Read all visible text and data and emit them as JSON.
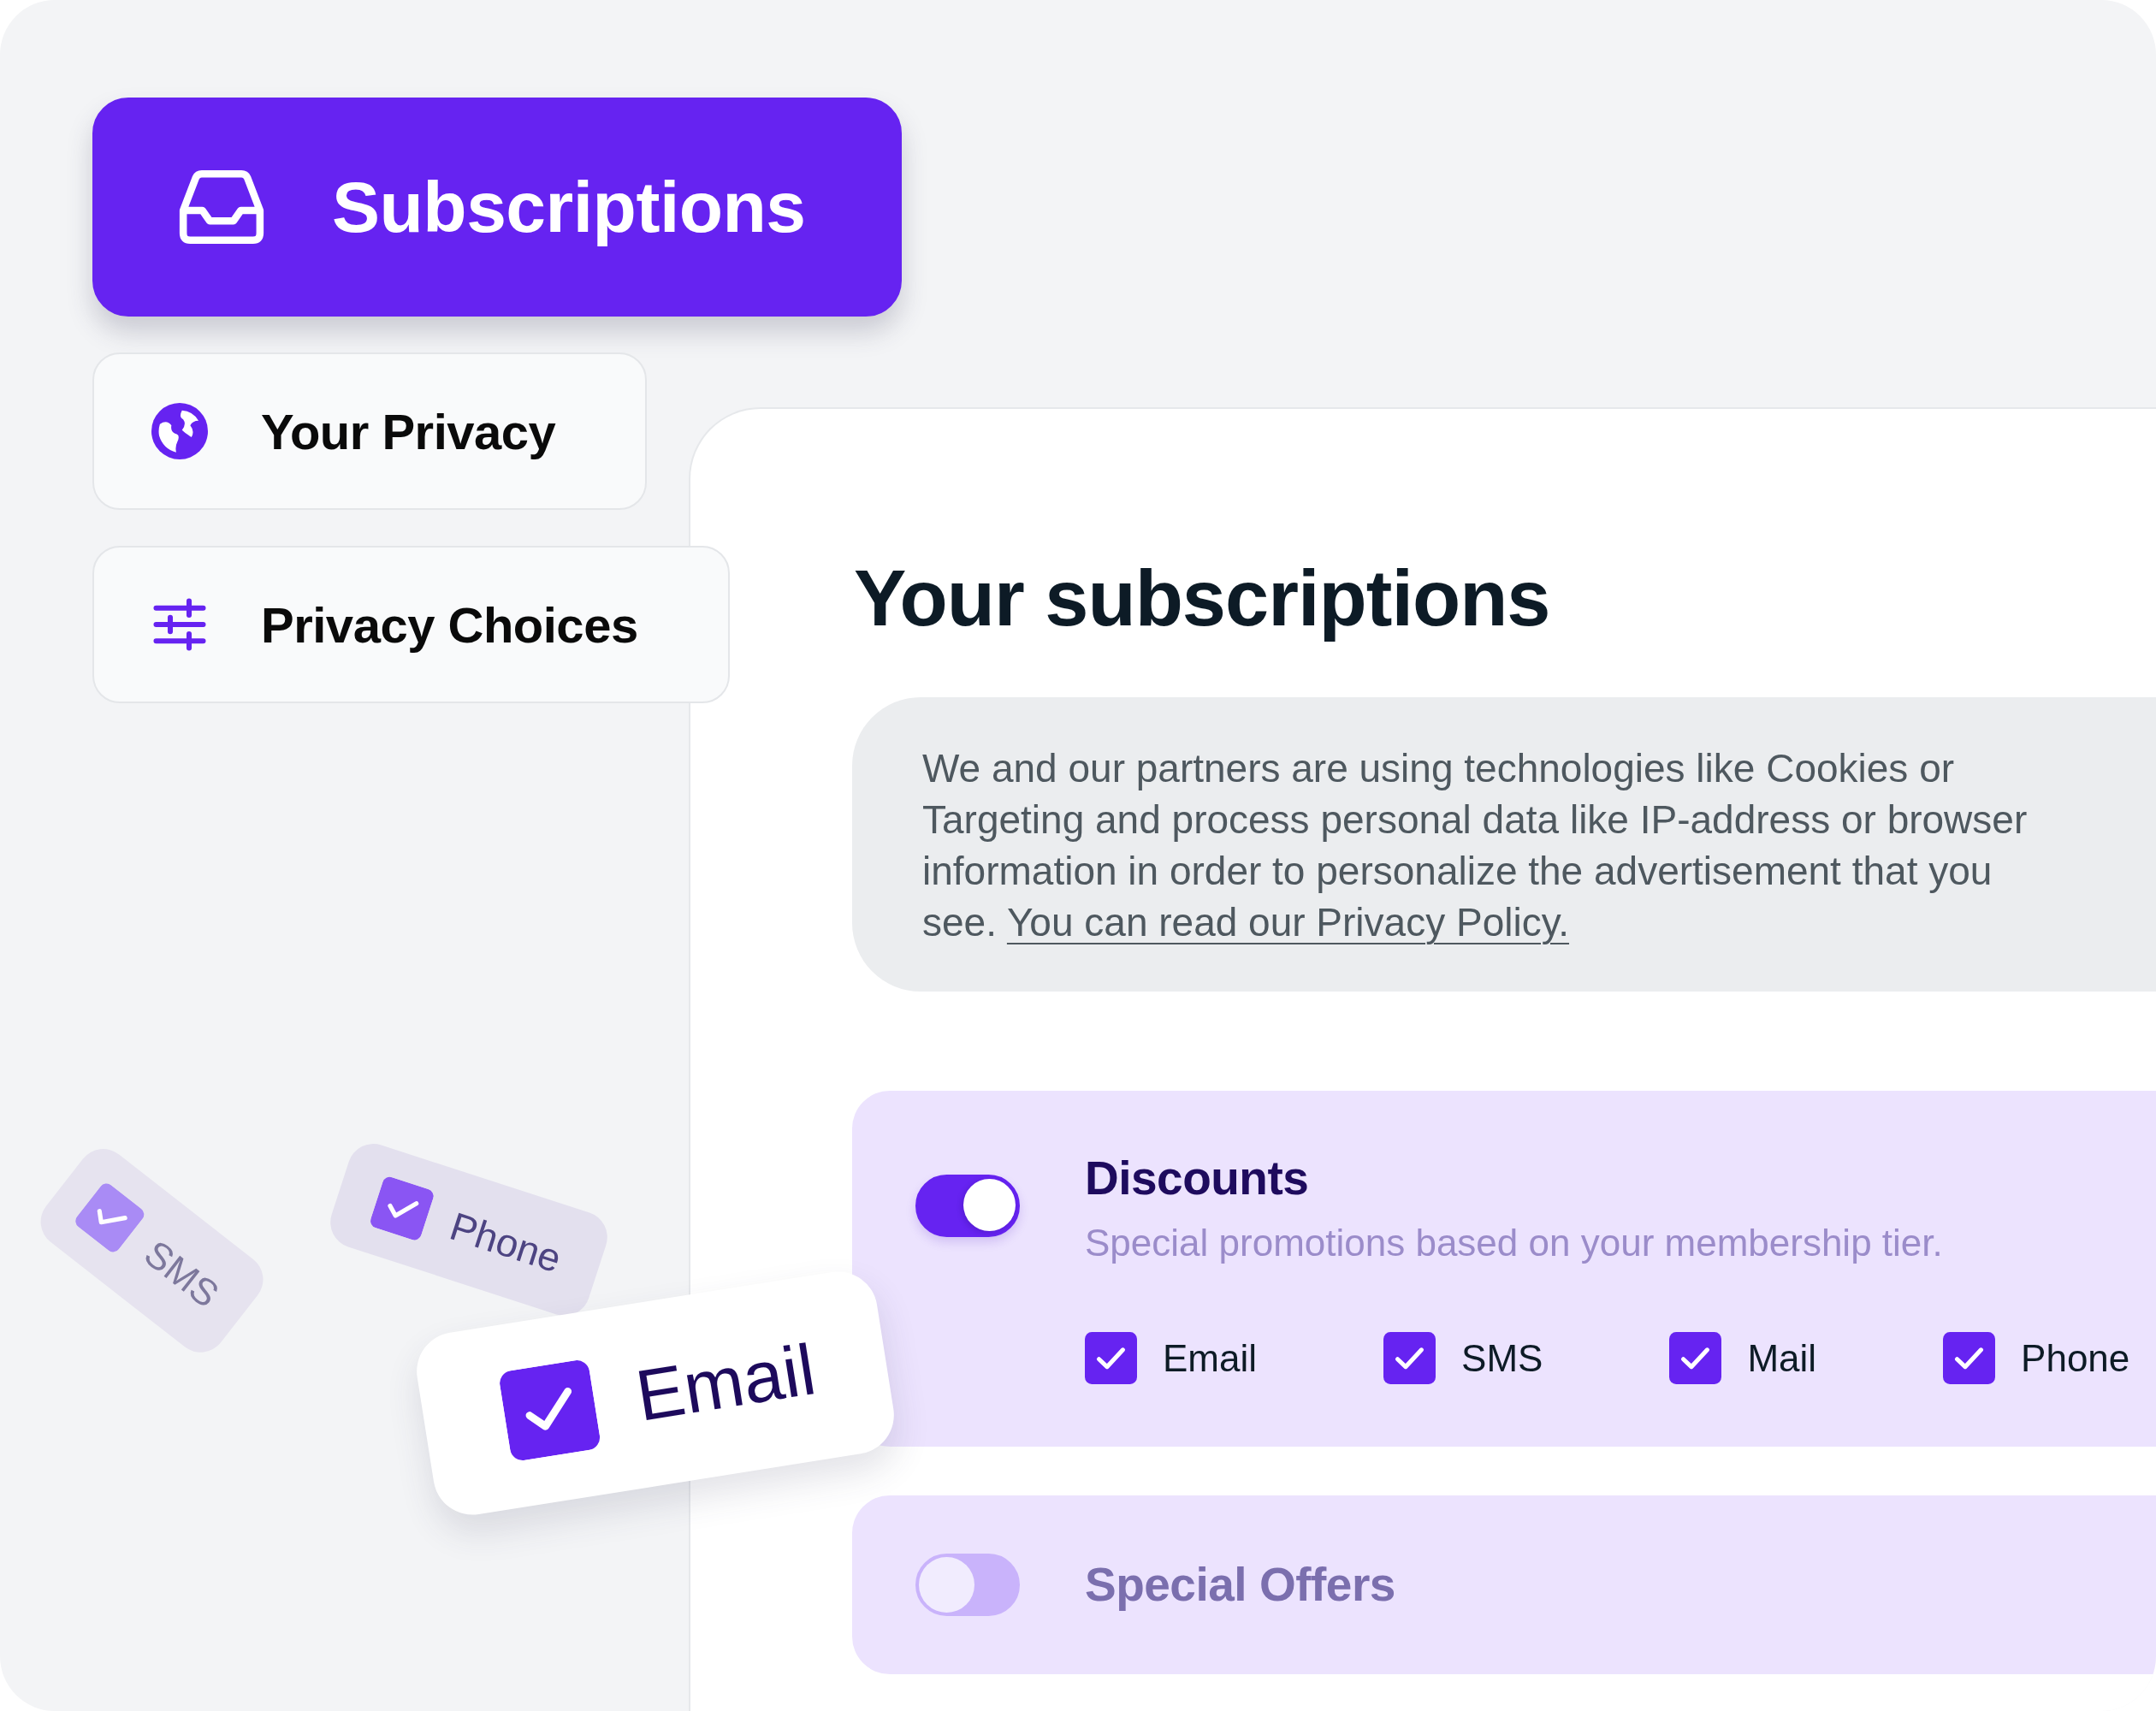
{
  "nav": [
    {
      "label": "Subscriptions",
      "selected": true
    },
    {
      "label": "Your Privacy",
      "selected": false
    },
    {
      "label": "Privacy Choices",
      "selected": false
    }
  ],
  "floating_chips": [
    {
      "label": "SMS",
      "checked": true,
      "kind": "back"
    },
    {
      "label": "Phone",
      "checked": true,
      "kind": "middle"
    },
    {
      "label": "Email",
      "checked": true,
      "kind": "front"
    }
  ],
  "main": {
    "title": "Your subscriptions",
    "notice": {
      "text": "We and our partners are using technologies like Cookies or Targeting and process personal data like IP-address or browser information in order to personalize the advertisement that you see.",
      "link": "You can read our Privacy Policy."
    },
    "subscriptions": [
      {
        "title": "Discounts",
        "on": true,
        "description": "Special promotions based on your membership tier.",
        "channels": [
          {
            "label": "Email",
            "checked": true
          },
          {
            "label": "SMS",
            "checked": true
          },
          {
            "label": "Mail",
            "checked": true
          },
          {
            "label": "Phone",
            "checked": true
          }
        ]
      },
      {
        "title": "Special Offers",
        "on": false
      }
    ]
  }
}
